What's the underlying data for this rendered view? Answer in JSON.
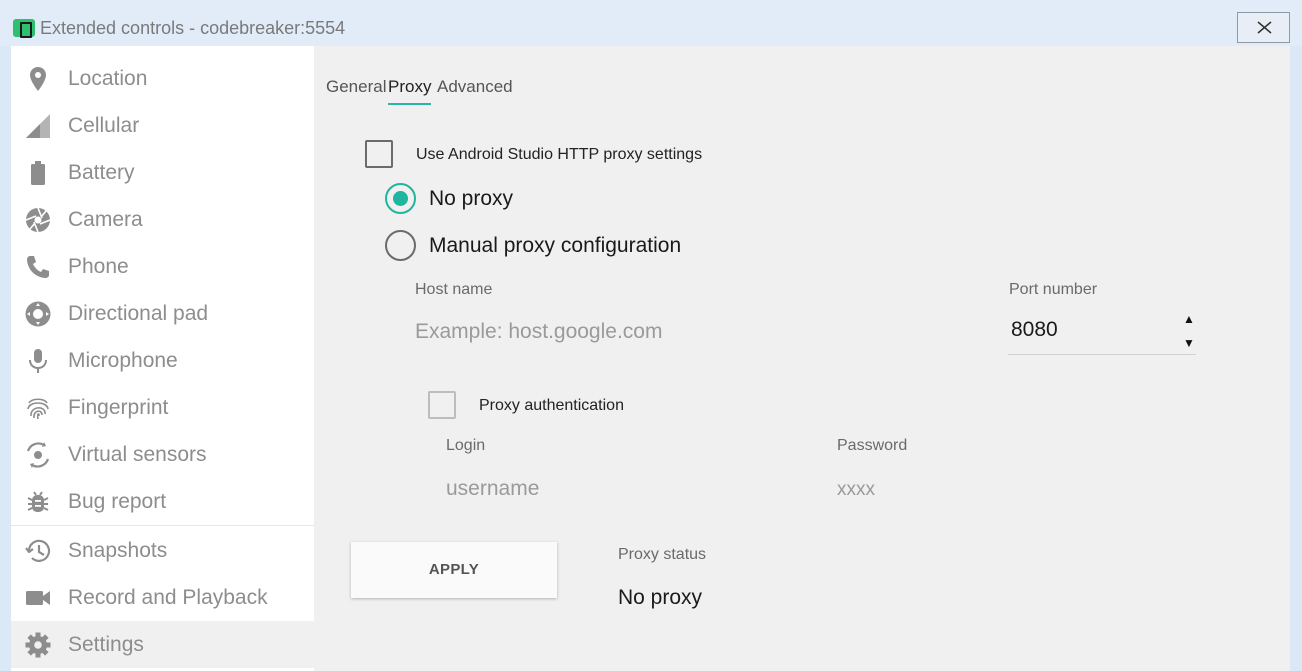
{
  "window": {
    "title": "Extended controls - codebreaker:5554",
    "close_icon": "close-icon"
  },
  "sidebar": {
    "items": [
      {
        "label": "Location",
        "icon": "location-pin-icon"
      },
      {
        "label": "Cellular",
        "icon": "cellular-signal-icon"
      },
      {
        "label": "Battery",
        "icon": "battery-icon"
      },
      {
        "label": "Camera",
        "icon": "camera-aperture-icon"
      },
      {
        "label": "Phone",
        "icon": "phone-icon"
      },
      {
        "label": "Directional pad",
        "icon": "dpad-icon"
      },
      {
        "label": "Microphone",
        "icon": "microphone-icon"
      },
      {
        "label": "Fingerprint",
        "icon": "fingerprint-icon"
      },
      {
        "label": "Virtual sensors",
        "icon": "virtual-sensors-icon"
      },
      {
        "label": "Bug report",
        "icon": "bug-icon"
      },
      {
        "label": "Snapshots",
        "icon": "history-icon"
      },
      {
        "label": "Record and Playback",
        "icon": "video-camera-icon"
      },
      {
        "label": "Settings",
        "icon": "gear-icon",
        "selected": true
      }
    ]
  },
  "tabs": [
    {
      "label": "General"
    },
    {
      "label": "Proxy",
      "active": true
    },
    {
      "label": "Advanced"
    }
  ],
  "proxy": {
    "use_studio_label": "Use Android Studio HTTP proxy settings",
    "use_studio_checked": false,
    "no_proxy_label": "No proxy",
    "manual_label": "Manual proxy configuration",
    "selected_mode": "No proxy",
    "host_label": "Host name",
    "host_placeholder": "Example: host.google.com",
    "port_label": "Port number",
    "port_value": "8080",
    "spin_up": "▲",
    "spin_down": "▼",
    "auth_label": "Proxy authentication",
    "auth_checked": false,
    "login_label": "Login",
    "login_placeholder": "username",
    "password_label": "Password",
    "password_placeholder": "xxxx",
    "apply_label": "APPLY",
    "status_label": "Proxy status",
    "status_value": "No proxy"
  },
  "colors": {
    "accent": "#1fb59e",
    "icon_gray": "#8d8d8d",
    "titlebar": "#e1ecf8"
  }
}
